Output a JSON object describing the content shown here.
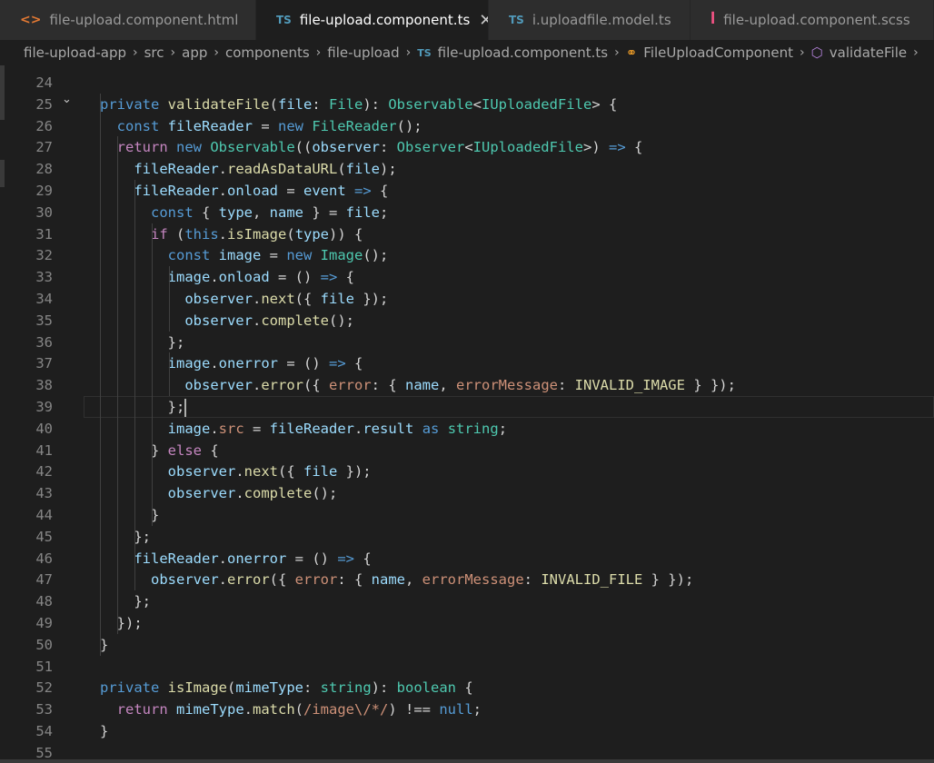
{
  "tabs": [
    {
      "icon": "html-icon",
      "glyph": "<>",
      "label": "file-upload.component.html",
      "active": false
    },
    {
      "icon": "ts-icon",
      "glyph": "TS",
      "label": "file-upload.component.ts",
      "active": true
    },
    {
      "icon": "ts-icon",
      "glyph": "TS",
      "label": "i.uploadfile.model.ts",
      "active": false
    },
    {
      "icon": "scss-icon",
      "glyph": "ꟾ",
      "label": "file-upload.component.scss",
      "active": false
    }
  ],
  "breadcrumb": {
    "segments": [
      "file-upload-app",
      "src",
      "app",
      "components",
      "file-upload"
    ],
    "file": "file-upload.component.ts",
    "file_icon": "TS",
    "class_name": "FileUploadComponent",
    "method_name": "validateFile"
  },
  "colors": {
    "keyword": "#569cd6",
    "control": "#c586c0",
    "function": "#dcdcaa",
    "type": "#4ec9b0",
    "variable": "#9cdcfe",
    "text": "#d4d4d4",
    "string": "#ce9178"
  },
  "editor": {
    "cursor_line": 39,
    "lines": [
      {
        "n": "24",
        "fold": false,
        "tokens": []
      },
      {
        "n": "25",
        "fold": true,
        "tokens": [
          [
            "kw",
            "  private "
          ],
          [
            "fn",
            "validateFile"
          ],
          [
            "txt",
            "("
          ],
          [
            "var",
            "file"
          ],
          [
            "txt",
            ": "
          ],
          [
            "type",
            "File"
          ],
          [
            "txt",
            "): "
          ],
          [
            "type",
            "Observable"
          ],
          [
            "txt",
            "<"
          ],
          [
            "type",
            "IUploadedFile"
          ],
          [
            "txt",
            "> {"
          ]
        ]
      },
      {
        "n": "26",
        "fold": false,
        "tokens": [
          [
            "kw",
            "    const "
          ],
          [
            "var",
            "fileReader"
          ],
          [
            "txt",
            " = "
          ],
          [
            "kw",
            "new "
          ],
          [
            "type",
            "FileReader"
          ],
          [
            "txt",
            "();"
          ]
        ]
      },
      {
        "n": "27",
        "fold": false,
        "tokens": [
          [
            "ctl",
            "    return "
          ],
          [
            "kw",
            "new "
          ],
          [
            "type",
            "Observable"
          ],
          [
            "txt",
            "(("
          ],
          [
            "var",
            "observer"
          ],
          [
            "txt",
            ": "
          ],
          [
            "type",
            "Observer"
          ],
          [
            "txt",
            "<"
          ],
          [
            "type",
            "IUploadedFile"
          ],
          [
            "txt",
            ">) "
          ],
          [
            "kw",
            "=>"
          ],
          [
            "txt",
            " {"
          ]
        ]
      },
      {
        "n": "28",
        "fold": false,
        "tokens": [
          [
            "var",
            "      fileReader"
          ],
          [
            "txt",
            "."
          ],
          [
            "fn",
            "readAsDataURL"
          ],
          [
            "txt",
            "("
          ],
          [
            "var",
            "file"
          ],
          [
            "txt",
            ");"
          ]
        ]
      },
      {
        "n": "29",
        "fold": false,
        "tokens": [
          [
            "var",
            "      fileReader"
          ],
          [
            "txt",
            "."
          ],
          [
            "prop",
            "onload"
          ],
          [
            "txt",
            " = "
          ],
          [
            "var",
            "event"
          ],
          [
            "txt",
            " "
          ],
          [
            "kw",
            "=>"
          ],
          [
            "txt",
            " {"
          ]
        ]
      },
      {
        "n": "30",
        "fold": false,
        "tokens": [
          [
            "kw",
            "        const "
          ],
          [
            "txt",
            "{ "
          ],
          [
            "var",
            "type"
          ],
          [
            "txt",
            ", "
          ],
          [
            "var",
            "name"
          ],
          [
            "txt",
            " } = "
          ],
          [
            "var",
            "file"
          ],
          [
            "txt",
            ";"
          ]
        ]
      },
      {
        "n": "31",
        "fold": false,
        "tokens": [
          [
            "ctl",
            "        if "
          ],
          [
            "txt",
            "("
          ],
          [
            "kw",
            "this"
          ],
          [
            "txt",
            "."
          ],
          [
            "fn",
            "isImage"
          ],
          [
            "txt",
            "("
          ],
          [
            "var",
            "type"
          ],
          [
            "txt",
            ")) {"
          ]
        ]
      },
      {
        "n": "32",
        "fold": false,
        "tokens": [
          [
            "kw",
            "          const "
          ],
          [
            "var",
            "image"
          ],
          [
            "txt",
            " = "
          ],
          [
            "kw",
            "new "
          ],
          [
            "type",
            "Image"
          ],
          [
            "txt",
            "();"
          ]
        ]
      },
      {
        "n": "33",
        "fold": false,
        "tokens": [
          [
            "var",
            "          image"
          ],
          [
            "txt",
            "."
          ],
          [
            "prop",
            "onload"
          ],
          [
            "txt",
            " = () "
          ],
          [
            "kw",
            "=>"
          ],
          [
            "txt",
            " {"
          ]
        ]
      },
      {
        "n": "34",
        "fold": false,
        "tokens": [
          [
            "var",
            "            observer"
          ],
          [
            "txt",
            "."
          ],
          [
            "fn",
            "next"
          ],
          [
            "txt",
            "({ "
          ],
          [
            "var",
            "file"
          ],
          [
            "txt",
            " });"
          ]
        ]
      },
      {
        "n": "35",
        "fold": false,
        "tokens": [
          [
            "var",
            "            observer"
          ],
          [
            "txt",
            "."
          ],
          [
            "fn",
            "complete"
          ],
          [
            "txt",
            "();"
          ]
        ]
      },
      {
        "n": "36",
        "fold": false,
        "tokens": [
          [
            "txt",
            "          };"
          ]
        ]
      },
      {
        "n": "37",
        "fold": false,
        "tokens": [
          [
            "var",
            "          image"
          ],
          [
            "txt",
            "."
          ],
          [
            "prop",
            "onerror"
          ],
          [
            "txt",
            " = () "
          ],
          [
            "kw",
            "=>"
          ],
          [
            "txt",
            " {"
          ]
        ]
      },
      {
        "n": "38",
        "fold": false,
        "tokens": [
          [
            "var",
            "            observer"
          ],
          [
            "txt",
            "."
          ],
          [
            "fn",
            "error"
          ],
          [
            "txt",
            "({ "
          ],
          [
            "str",
            "error"
          ],
          [
            "txt",
            ": { "
          ],
          [
            "var",
            "name"
          ],
          [
            "txt",
            ", "
          ],
          [
            "str",
            "errorMessage"
          ],
          [
            "txt",
            ": "
          ],
          [
            "fn",
            "INVALID_IMAGE"
          ],
          [
            "txt",
            " } });"
          ]
        ]
      },
      {
        "n": "39",
        "fold": false,
        "tokens": [
          [
            "txt",
            "          };"
          ]
        ]
      },
      {
        "n": "40",
        "fold": false,
        "tokens": [
          [
            "var",
            "          image"
          ],
          [
            "txt",
            "."
          ],
          [
            "str",
            "src"
          ],
          [
            "txt",
            " = "
          ],
          [
            "var",
            "fileReader"
          ],
          [
            "txt",
            "."
          ],
          [
            "var",
            "result"
          ],
          [
            "txt",
            " "
          ],
          [
            "kw",
            "as "
          ],
          [
            "type",
            "string"
          ],
          [
            "txt",
            ";"
          ]
        ]
      },
      {
        "n": "41",
        "fold": false,
        "tokens": [
          [
            "txt",
            "        } "
          ],
          [
            "ctl",
            "else"
          ],
          [
            "txt",
            " {"
          ]
        ]
      },
      {
        "n": "42",
        "fold": false,
        "tokens": [
          [
            "var",
            "          observer"
          ],
          [
            "txt",
            "."
          ],
          [
            "fn",
            "next"
          ],
          [
            "txt",
            "({ "
          ],
          [
            "var",
            "file"
          ],
          [
            "txt",
            " });"
          ]
        ]
      },
      {
        "n": "43",
        "fold": false,
        "tokens": [
          [
            "var",
            "          observer"
          ],
          [
            "txt",
            "."
          ],
          [
            "fn",
            "complete"
          ],
          [
            "txt",
            "();"
          ]
        ]
      },
      {
        "n": "44",
        "fold": false,
        "tokens": [
          [
            "txt",
            "        }"
          ]
        ]
      },
      {
        "n": "45",
        "fold": false,
        "tokens": [
          [
            "txt",
            "      };"
          ]
        ]
      },
      {
        "n": "46",
        "fold": false,
        "tokens": [
          [
            "var",
            "      fileReader"
          ],
          [
            "txt",
            "."
          ],
          [
            "prop",
            "onerror"
          ],
          [
            "txt",
            " = () "
          ],
          [
            "kw",
            "=>"
          ],
          [
            "txt",
            " {"
          ]
        ]
      },
      {
        "n": "47",
        "fold": false,
        "tokens": [
          [
            "var",
            "        observer"
          ],
          [
            "txt",
            "."
          ],
          [
            "fn",
            "error"
          ],
          [
            "txt",
            "({ "
          ],
          [
            "str",
            "error"
          ],
          [
            "txt",
            ": { "
          ],
          [
            "var",
            "name"
          ],
          [
            "txt",
            ", "
          ],
          [
            "str",
            "errorMessage"
          ],
          [
            "txt",
            ": "
          ],
          [
            "fn",
            "INVALID_FILE"
          ],
          [
            "txt",
            " } });"
          ]
        ]
      },
      {
        "n": "48",
        "fold": false,
        "tokens": [
          [
            "txt",
            "      };"
          ]
        ]
      },
      {
        "n": "49",
        "fold": false,
        "tokens": [
          [
            "txt",
            "    });"
          ]
        ]
      },
      {
        "n": "50",
        "fold": false,
        "tokens": [
          [
            "txt",
            "  }"
          ]
        ]
      },
      {
        "n": "51",
        "fold": false,
        "tokens": []
      },
      {
        "n": "52",
        "fold": false,
        "tokens": [
          [
            "kw",
            "  private "
          ],
          [
            "fn",
            "isImage"
          ],
          [
            "txt",
            "("
          ],
          [
            "var",
            "mimeType"
          ],
          [
            "txt",
            ": "
          ],
          [
            "type",
            "string"
          ],
          [
            "txt",
            "): "
          ],
          [
            "type",
            "boolean"
          ],
          [
            "txt",
            " {"
          ]
        ]
      },
      {
        "n": "53",
        "fold": false,
        "tokens": [
          [
            "ctl",
            "    return "
          ],
          [
            "var",
            "mimeType"
          ],
          [
            "txt",
            "."
          ],
          [
            "fn",
            "match"
          ],
          [
            "txt",
            "("
          ],
          [
            "str",
            "/image\\/*/"
          ],
          [
            "txt",
            ") !== "
          ],
          [
            "kw",
            "null"
          ],
          [
            "txt",
            ";"
          ]
        ]
      },
      {
        "n": "54",
        "fold": false,
        "tokens": [
          [
            "txt",
            "  }"
          ]
        ]
      },
      {
        "n": "55",
        "fold": false,
        "tokens": []
      }
    ]
  }
}
